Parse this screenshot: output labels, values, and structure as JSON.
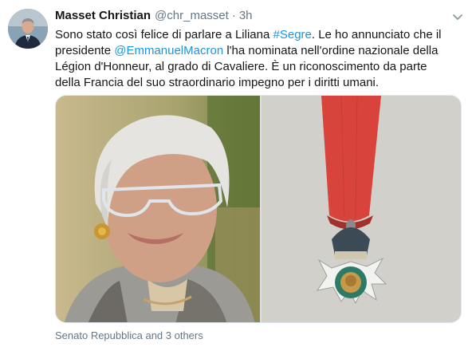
{
  "tweet": {
    "author_name": "Masset Christian",
    "handle": "@chr_masset",
    "separator": "·",
    "time": "3h",
    "text": {
      "l1_a": "Sono stato così felice di parlare a Liliana ",
      "l1_hashtag": "#Segre",
      "l1_b": ". Le ho annunciato che il",
      "l2_a": "presidente ",
      "l2_mention": "@EmmanuelMacron",
      "l2_b": " l'ha nominata nell'ordine nazionale della",
      "l3": "Légion d'Honneur, al grado di Cavaliere. È un riconoscimento da parte",
      "l4": "della Francia del suo straordinario impegno per i diritti umani."
    },
    "media": {
      "left_image": "photo-portrait",
      "right_image": "photo-medal"
    },
    "footer": "Senato Repubblica and 3 others"
  },
  "icons": {
    "more": "chevron-down-icon"
  }
}
